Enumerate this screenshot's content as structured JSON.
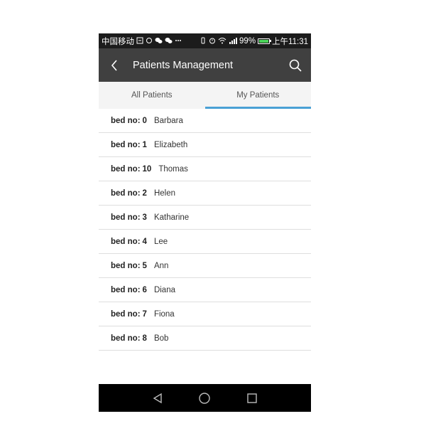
{
  "status_bar": {
    "carrier": "中国移动",
    "battery_percent": "99%",
    "battery_level": 0.99,
    "time": "上午11:31"
  },
  "app_bar": {
    "title": "Patients Management",
    "back_icon": "chevron-left-icon",
    "search_icon": "search-icon"
  },
  "tabs": [
    {
      "label": "All Patients",
      "active": false
    },
    {
      "label": "My Patients",
      "active": true
    }
  ],
  "bed_prefix": "bed no:",
  "patients": [
    {
      "bed": "0",
      "name": "Barbara"
    },
    {
      "bed": "1",
      "name": "Elizabeth"
    },
    {
      "bed": "10",
      "name": "Thomas"
    },
    {
      "bed": "2",
      "name": "Helen"
    },
    {
      "bed": "3",
      "name": "Katharine"
    },
    {
      "bed": "4",
      "name": "Lee"
    },
    {
      "bed": "5",
      "name": "Ann"
    },
    {
      "bed": "6",
      "name": "Diana"
    },
    {
      "bed": "7",
      "name": "Fiona"
    },
    {
      "bed": "8",
      "name": "Bob"
    }
  ],
  "nav_bar": {
    "icons": [
      "back-triangle-icon",
      "home-circle-icon",
      "recents-square-icon"
    ]
  },
  "colors": {
    "app_bar": "#404040",
    "tab_indicator": "#4aa0d5",
    "status_bar": "#1c1c1c",
    "nav_bar": "#000000"
  }
}
